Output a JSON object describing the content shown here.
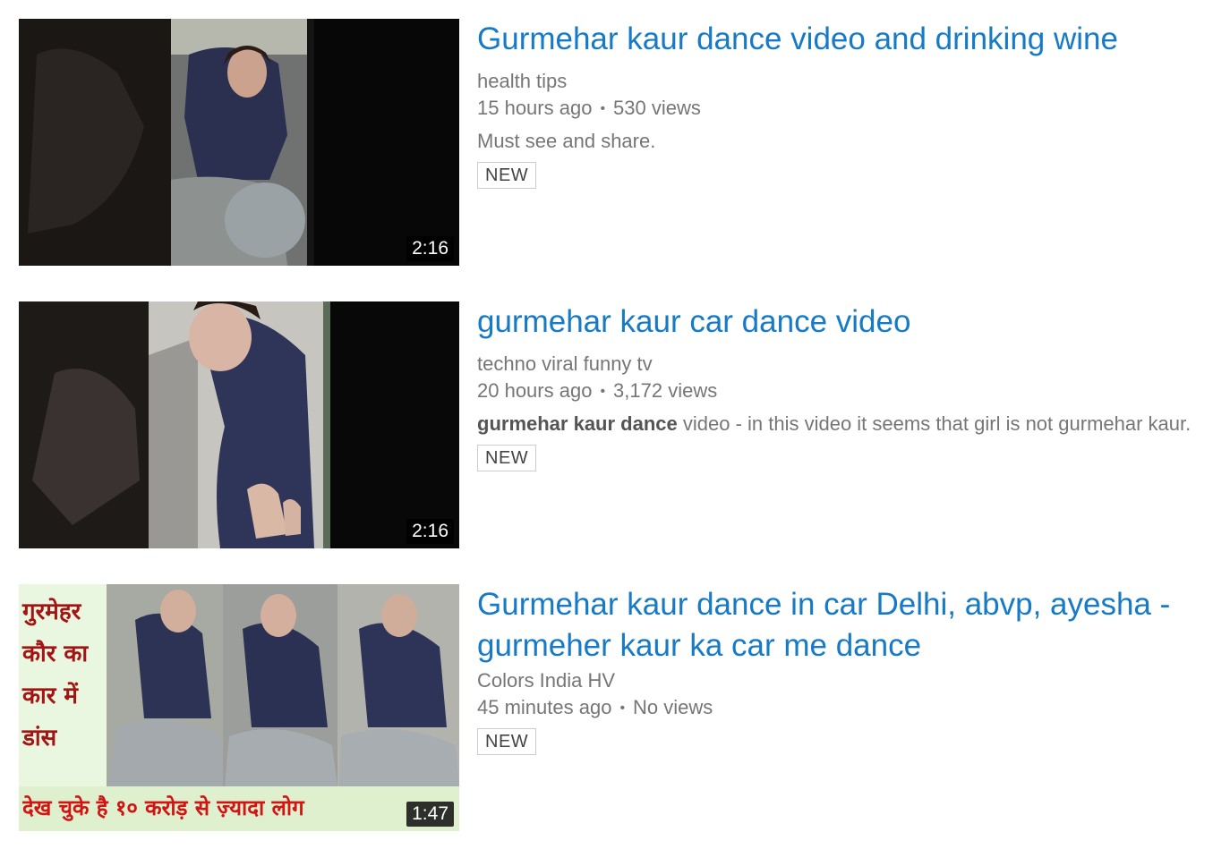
{
  "results": [
    {
      "title": "Gurmehar kaur dance video and drinking wine",
      "channel": "health tips",
      "age": "15 hours ago",
      "views": "530 views",
      "description": "Must see and share.",
      "badge": "NEW",
      "duration": "2:16"
    },
    {
      "title": "gurmehar kaur car dance video",
      "channel": "techno viral funny tv",
      "age": "20 hours ago",
      "views": "3,172 views",
      "description_bold": "gurmehar kaur dance",
      "description_rest": " video - in this video it seems that girl is not gurmehar kaur.",
      "badge": "NEW",
      "duration": "2:16"
    },
    {
      "title": "Gurmehar kaur dance in car Delhi, abvp, ayesha - gurmeher kaur ka car me dance",
      "channel": "Colors India HV",
      "age": "45 minutes ago",
      "views": "No views",
      "badge": "NEW",
      "duration": "1:47",
      "thumb_text_lines": [
        "गुरमेहर",
        "कौर का",
        "कार में",
        "डांस"
      ],
      "thumb_caption": "देख चुके है १० करोड़ से ज़्यादा लोग"
    }
  ],
  "meta_separator": "•",
  "colors": {
    "title_link": "#167ac6",
    "secondary_text": "#767676",
    "thumb_bg": "#0b0b0b",
    "thumb3_bg": "#e9f7e0",
    "thumb3_left_text": "#a31414",
    "thumb3_caption_text": "#d11515"
  }
}
